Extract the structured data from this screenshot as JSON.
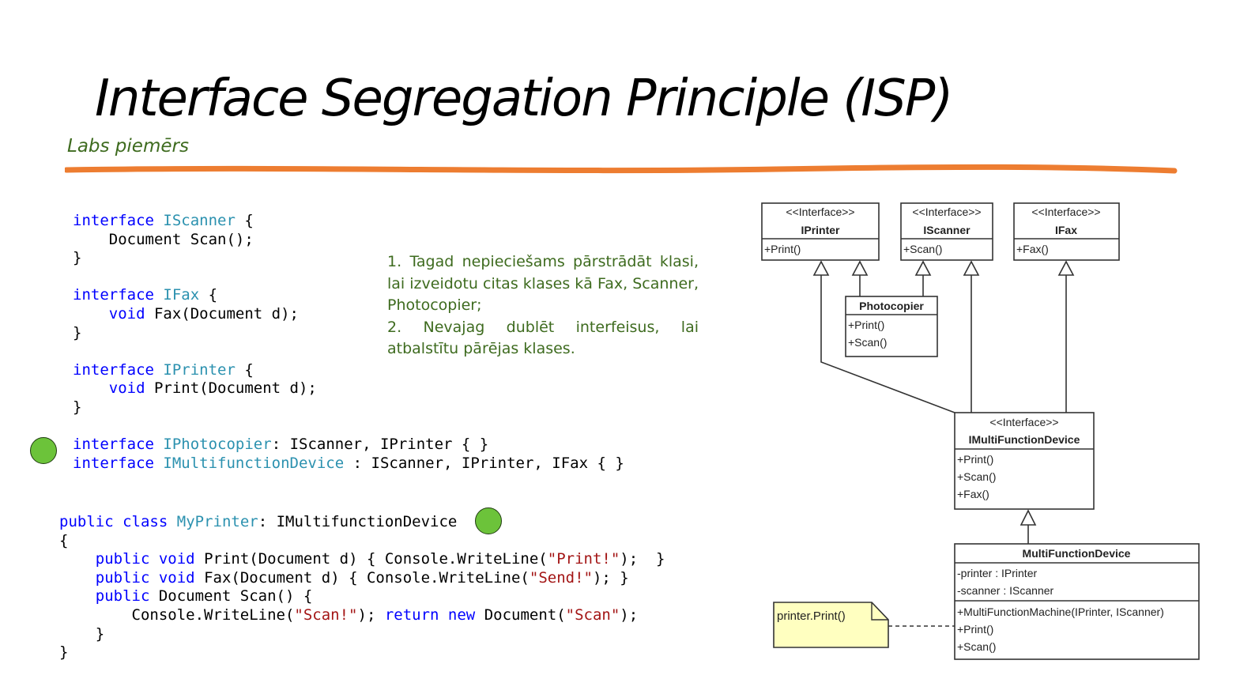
{
  "slide": {
    "title_main": "Interface Segregation Principle",
    "title_paren": "(ISP)",
    "subtitle": "Labs piemērs"
  },
  "code_block": {
    "iscanner": {
      "kw": "interface",
      "name": "IScanner",
      "rest": " {",
      "body": "Document Scan();",
      "close": "}"
    },
    "ifax": {
      "kw": "interface",
      "name": "IFax",
      "rest": " {",
      "body_kw": "void",
      "body": " Fax(Document d);",
      "close": "}"
    },
    "iprinter": {
      "kw": "interface",
      "name": "IPrinter",
      "rest": " {",
      "body_kw": "void",
      "body": " Print(Document d);",
      "close": "}"
    },
    "iphotocopier": {
      "kw": "interface",
      "name": "IPhotocopier",
      "rest": ": IScanner, IPrinter { }"
    },
    "imultifunction": {
      "kw": "interface",
      "name": "IMultifunctionDevice",
      "rest": " : IScanner, IPrinter, IFax { }"
    },
    "myprinter": {
      "kw1": "public",
      "kw2": "class",
      "name": "MyPrinter",
      "rest": ": IMultifunctionDevice",
      "open": "{",
      "print_pre": "public",
      "print_kw": "void",
      "print_mid": " Print(Document d) { Console.WriteLine(",
      "print_str": "\"Print!\"",
      "print_end": ");  }",
      "fax_pre": "public",
      "fax_kw": "void",
      "fax_mid": " Fax(Document d) { Console.WriteLine(",
      "fax_str": "\"Send!\"",
      "fax_end": "); }",
      "scan_pre": "public",
      "scan_mid": " Document Scan() {",
      "scan_body_a": "Console.WriteLine(",
      "scan_body_str": "\"Scan!\"",
      "scan_body_b": "); ",
      "scan_ret": "return",
      "scan_new": "new",
      "scan_doc": " Document(",
      "scan_doc_str": "\"Scan\"",
      "scan_doc_end": ");",
      "inner_close": "}",
      "close": "}"
    }
  },
  "notes": [
    "1. Tagad nepieciešams pārstrādāt klasi, lai izveidotu citas klases kā Fax, Scanner, Photocopier;",
    "2. Nevajag dublēt interfeisus, lai atbalstītu pārējas klases."
  ],
  "uml": {
    "stereotype": "<<Interface>>",
    "iprinter": {
      "name": "IPrinter",
      "ops": [
        "+Print()"
      ]
    },
    "iscanner": {
      "name": "IScanner",
      "ops": [
        "+Scan()"
      ]
    },
    "ifax": {
      "name": "IFax",
      "ops": [
        "+Fax()"
      ]
    },
    "photocopier": {
      "name": "Photocopier",
      "ops": [
        "+Print()",
        "+Scan()"
      ]
    },
    "imfd": {
      "name": "IMultiFunctionDevice",
      "ops": [
        "+Print()",
        "+Scan()",
        "+Fax()"
      ]
    },
    "mfd": {
      "name": "MultiFunctionDevice",
      "attrs": [
        "-printer : IPrinter",
        "-scanner : IScanner"
      ],
      "ops": [
        "+MultiFunctionMachine(IPrinter, IScanner)",
        "+Print()",
        "+Scan()"
      ]
    },
    "note": "printer.Print()"
  },
  "colors": {
    "accent_line": "#ed7d31",
    "note_text": "#3e6b1f",
    "dot": "#6cc33a",
    "uml_note_fill": "#ffffc0"
  }
}
